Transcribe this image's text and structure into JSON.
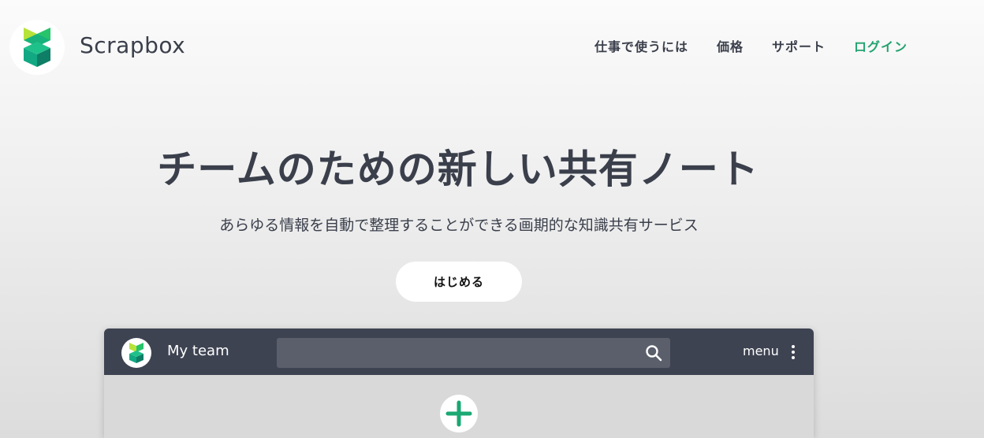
{
  "header": {
    "brand": "Scrapbox",
    "nav": [
      {
        "label": "仕事で使うには"
      },
      {
        "label": "価格"
      },
      {
        "label": "サポート"
      },
      {
        "label": "ログイン"
      }
    ],
    "login_color": "#22a36f"
  },
  "hero": {
    "title": "チームのための新しい共有ノート",
    "subtitle": "あらゆる情報を自動で整理することができる画期的な知識共有サービス",
    "cta_label": "はじめる"
  },
  "app_preview": {
    "team_name": "My team",
    "search_placeholder": "",
    "menu_label": "menu",
    "bar_color": "#3e4352",
    "icons": [
      "scrapbox-logo-icon",
      "search-icon",
      "kebab-menu-icon",
      "plus-icon"
    ]
  }
}
